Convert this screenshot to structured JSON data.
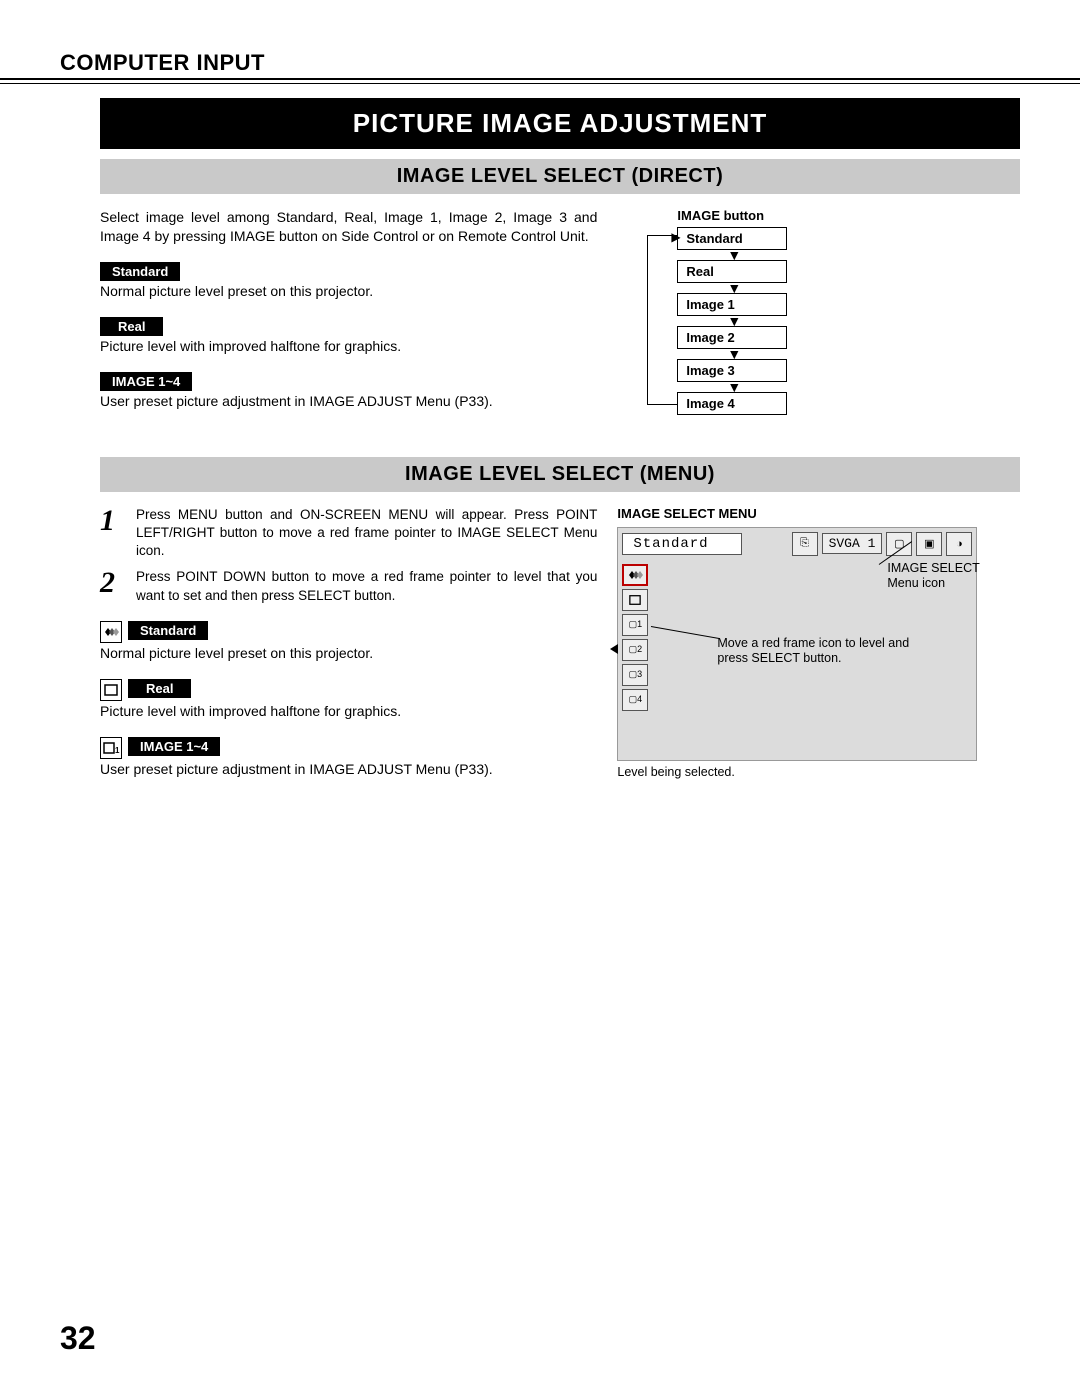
{
  "header": "COMPUTER INPUT",
  "title_banner": "PICTURE IMAGE ADJUSTMENT",
  "sec1": {
    "banner": "IMAGE LEVEL SELECT (DIRECT)",
    "intro": "Select image level among Standard, Real, Image 1, Image 2, Image 3 and Image 4 by pressing IMAGE button on Side Control or on Remote Control Unit.",
    "items": [
      {
        "label": "Standard",
        "desc": "Normal picture level preset on this projector."
      },
      {
        "label": "Real",
        "desc": "Picture level with improved halftone for graphics."
      },
      {
        "label": "IMAGE 1~4",
        "desc": "User preset picture adjustment in IMAGE ADJUST Menu (P33)."
      }
    ],
    "diagram_title": "IMAGE button",
    "diagram_boxes": [
      "Standard",
      "Real",
      "Image 1",
      "Image 2",
      "Image 3",
      "Image 4"
    ]
  },
  "sec2": {
    "banner": "IMAGE LEVEL SELECT (MENU)",
    "steps": [
      "Press MENU button and ON-SCREEN MENU will appear.  Press POINT LEFT/RIGHT button to move a red frame pointer to IMAGE SELECT Menu icon.",
      "Press POINT DOWN button to move a red frame pointer to level that you want to set and then press SELECT button."
    ],
    "items": [
      {
        "label": "Standard",
        "desc": "Normal picture level preset on this projector."
      },
      {
        "label": "Real",
        "desc": "Picture level with improved halftone for graphics."
      },
      {
        "label": "IMAGE 1~4",
        "desc": "User preset picture adjustment in IMAGE ADJUST Menu (P33)."
      }
    ],
    "menu_title": "IMAGE SELECT MENU",
    "osd": {
      "status": "Standard",
      "svga": "SVGA 1",
      "annot_menuicon": "IMAGE SELECT Menu icon",
      "annot_move": "Move a red frame icon to level and press SELECT button.",
      "caption": "Level being selected."
    }
  },
  "page_number": "32"
}
